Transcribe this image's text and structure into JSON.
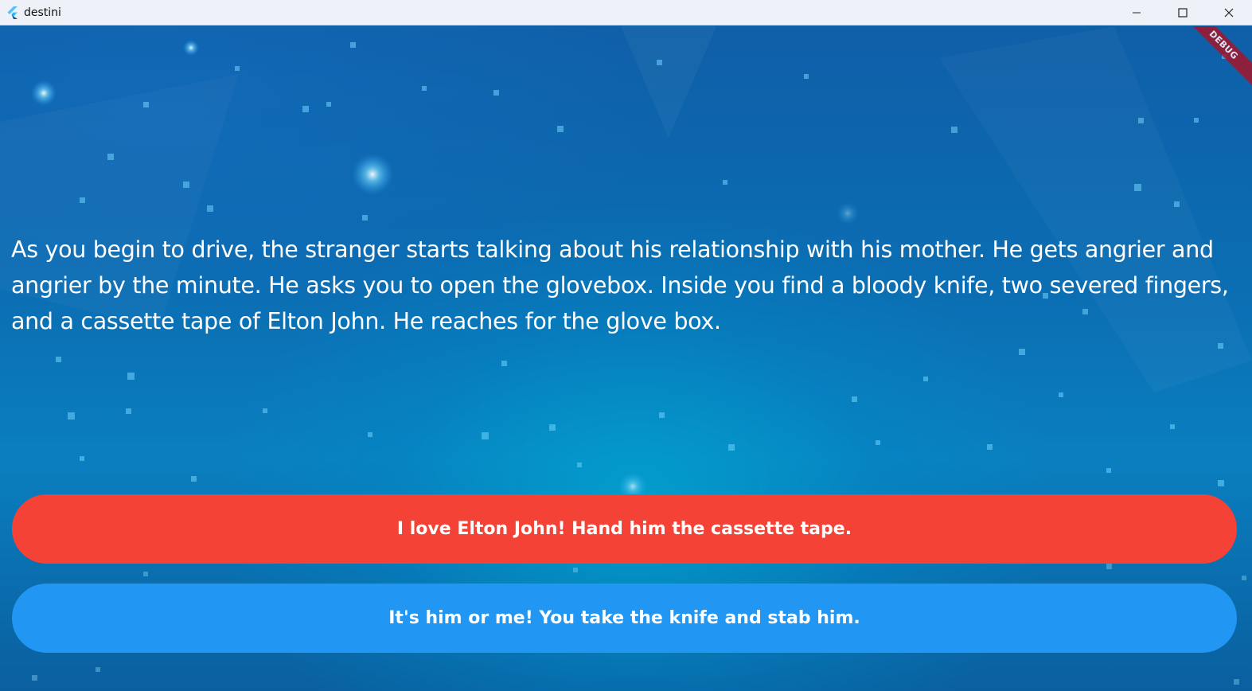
{
  "window": {
    "title": "destini",
    "controls": {
      "minimize": "minimize-icon",
      "maximize": "maximize-icon",
      "close": "close-icon"
    }
  },
  "banner": {
    "label": "DEBUG",
    "color": "#a3152b"
  },
  "story": {
    "text": "As you begin to drive, the stranger starts talking about his relationship with his mother. He gets angrier and angrier by the minute. He asks you to open the glovebox. Inside you find a bloody knife, two severed fingers, and a cassette tape of Elton John. He reaches for the glove box."
  },
  "choices": [
    {
      "label": "I love Elton John! Hand him the cassette tape.",
      "color": "#f44336"
    },
    {
      "label": "It's him or me! You take the knife and stab him.",
      "color": "#2196f3"
    }
  ]
}
